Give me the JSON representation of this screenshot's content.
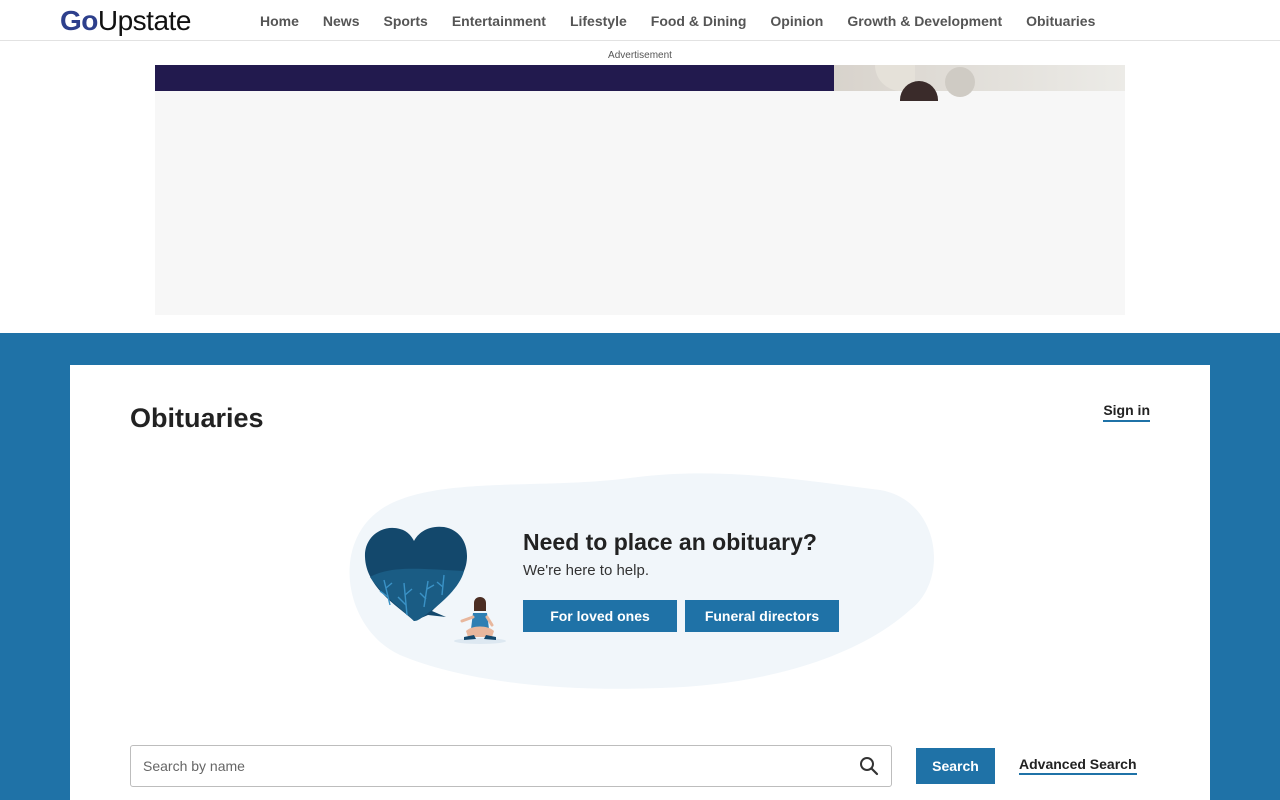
{
  "brand": {
    "logo_part1": "Go",
    "logo_part2": "Upstate"
  },
  "nav": {
    "items": [
      {
        "label": "Home"
      },
      {
        "label": "News"
      },
      {
        "label": "Sports"
      },
      {
        "label": "Entertainment"
      },
      {
        "label": "Lifestyle"
      },
      {
        "label": "Food & Dining"
      },
      {
        "label": "Opinion"
      },
      {
        "label": "Growth & Development"
      },
      {
        "label": "Obituaries"
      }
    ]
  },
  "ad": {
    "label": "Advertisement"
  },
  "page": {
    "title": "Obituaries",
    "signin_label": "Sign in"
  },
  "promo": {
    "heading": "Need to place an obituary?",
    "subheading": "We're here to help.",
    "btn_loved_ones": "For loved ones",
    "btn_funeral_directors": "Funeral directors"
  },
  "search": {
    "placeholder": "Search by name",
    "value": "",
    "button_label": "Search",
    "advanced_label": "Advanced Search",
    "icon": "search-icon"
  },
  "colors": {
    "accent": "#1f72a7",
    "logo_blue": "#2d3f8c",
    "blob": "#f1f6fa"
  }
}
